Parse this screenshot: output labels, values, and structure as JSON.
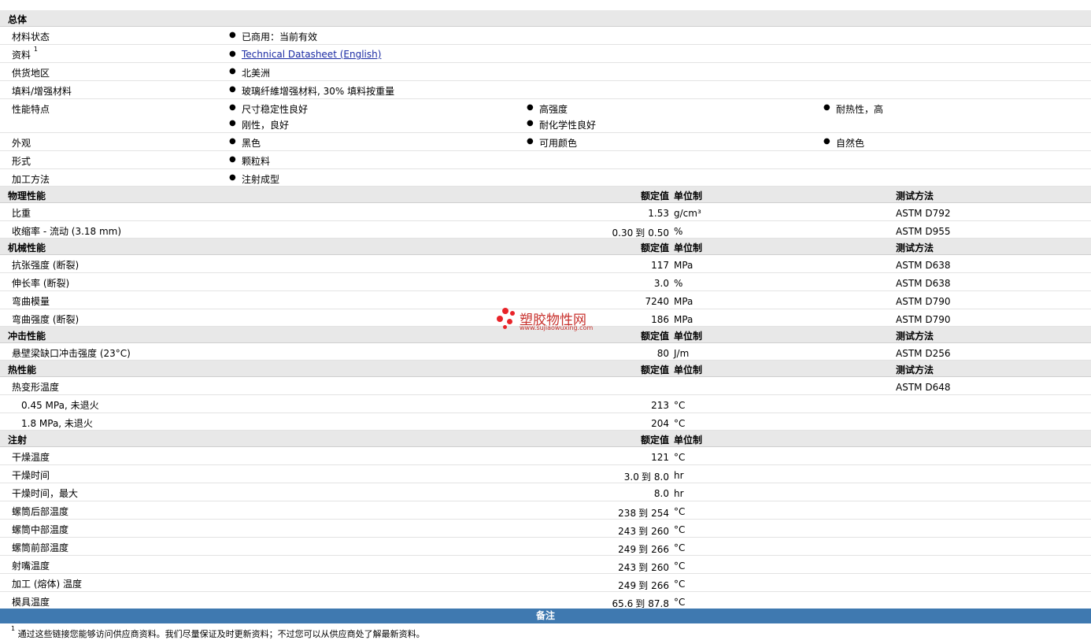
{
  "general": {
    "title": "总体",
    "rows": [
      {
        "label": "材料状态",
        "items": [
          "已商用：当前有效"
        ]
      },
      {
        "label": "资料",
        "sup": "1",
        "link": "Technical Datasheet (English)"
      },
      {
        "label": "供货地区",
        "items": [
          "北美洲"
        ]
      },
      {
        "label": "填料/增强材料",
        "items": [
          "玻璃纤維增强材料, 30% 填料按重量"
        ]
      },
      {
        "label": "性能特点",
        "items": [
          "尺寸稳定性良好",
          "高强度",
          "耐热性，高",
          "刚性，良好",
          "耐化学性良好"
        ]
      },
      {
        "label": "外观",
        "items": [
          "黑色",
          "可用颜色",
          "自然色"
        ]
      },
      {
        "label": "形式",
        "items": [
          "颗粒料"
        ]
      },
      {
        "label": "加工方法",
        "items": [
          "注射成型"
        ]
      }
    ]
  },
  "headers": {
    "value": "额定值",
    "unit": "单位制",
    "method": "测试方法"
  },
  "physical": {
    "title": "物理性能",
    "rows": [
      {
        "label": "比重",
        "value": "1.53",
        "unit": "g/cm³",
        "method": "ASTM D792"
      },
      {
        "label": "收缩率 - 流动 (3.18 mm)",
        "low": "0.30",
        "to": "到",
        "high": "0.50",
        "unit": "%",
        "method": "ASTM D955"
      }
    ]
  },
  "mechanical": {
    "title": "机械性能",
    "rows": [
      {
        "label": "抗张强度 (断裂)",
        "value": "117",
        "unit": "MPa",
        "method": "ASTM D638"
      },
      {
        "label": "伸长率 (断裂)",
        "value": "3.0",
        "unit": "%",
        "method": "ASTM D638"
      },
      {
        "label": "弯曲模量",
        "value": "7240",
        "unit": "MPa",
        "method": "ASTM D790"
      },
      {
        "label": "弯曲强度 (断裂)",
        "value": "186",
        "unit": "MPa",
        "method": "ASTM D790"
      }
    ]
  },
  "impact": {
    "title": "冲击性能",
    "rows": [
      {
        "label": "悬壁梁缺口冲击强度 (23°C)",
        "value": "80",
        "unit": "J/m",
        "method": "ASTM D256"
      }
    ]
  },
  "thermal": {
    "title": "热性能",
    "rows": [
      {
        "label": "热变形温度",
        "method": "ASTM D648"
      },
      {
        "label": "0.45 MPa, 未退火",
        "value": "213",
        "unit": "°C"
      },
      {
        "label": "1.8 MPa, 未退火",
        "value": "204",
        "unit": "°C"
      }
    ]
  },
  "injection": {
    "title": "注射",
    "rows": [
      {
        "label": "干燥温度",
        "value": "121",
        "unit": "°C"
      },
      {
        "label": "干燥时间",
        "low": "3.0",
        "to": "到",
        "high": "8.0",
        "unit": "hr"
      },
      {
        "label": "干燥时间，最大",
        "value": "8.0",
        "unit": "hr"
      },
      {
        "label": "螺筒后部温度",
        "low": "238",
        "to": "到",
        "high": "254",
        "unit": "°C"
      },
      {
        "label": "螺筒中部温度",
        "low": "243",
        "to": "到",
        "high": "260",
        "unit": "°C"
      },
      {
        "label": "螺筒前部温度",
        "low": "249",
        "to": "到",
        "high": "266",
        "unit": "°C"
      },
      {
        "label": "射嘴温度",
        "low": "243",
        "to": "到",
        "high": "260",
        "unit": "°C"
      },
      {
        "label": "加工 (熔体) 温度",
        "low": "249",
        "to": "到",
        "high": "266",
        "unit": "°C"
      },
      {
        "label": "模具温度",
        "low": "65.6",
        "to": "到",
        "high": "87.8",
        "unit": "°C"
      }
    ]
  },
  "notes": {
    "title": "备注",
    "footnote_mark": "1",
    "footnote": "通过这些链接您能够访问供应商资料。我们尽量保证及时更新资料；不过您可以从供应商处了解最新资料。"
  },
  "watermark": {
    "text": "塑胶物性网",
    "url": "www.sujiaowuxing.com",
    "color": "#e8242a"
  }
}
